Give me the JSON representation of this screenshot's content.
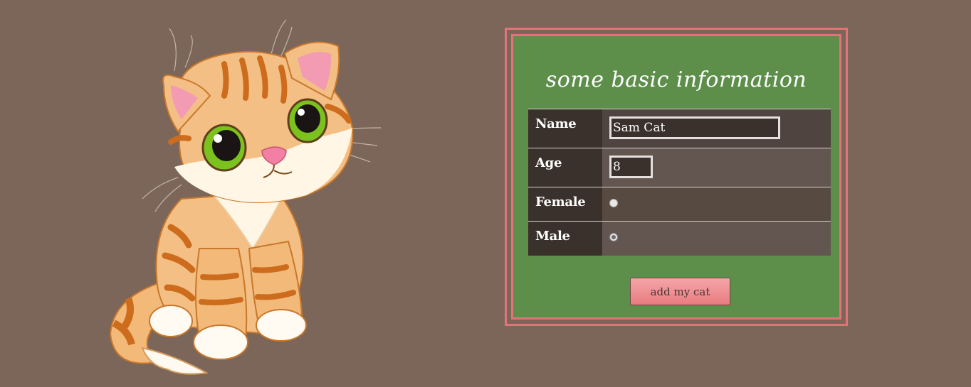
{
  "form": {
    "title": "some basic information",
    "fields": {
      "name": {
        "label": "Name",
        "value": "Sam Cat"
      },
      "age": {
        "label": "Age",
        "value": "8"
      },
      "female": {
        "label": "Female",
        "checked": false
      },
      "male": {
        "label": "Male",
        "checked": true
      }
    },
    "submit_label": "add my cat"
  },
  "colors": {
    "page_background": "#7b6659",
    "form_background": "#5d8e4a",
    "frame_border": "#e07478",
    "label_cell": "#3b312c",
    "button_top": "#f5a5a8",
    "button_bottom": "#e87c80"
  },
  "illustration": "cartoon-orange-tabby-kitten"
}
